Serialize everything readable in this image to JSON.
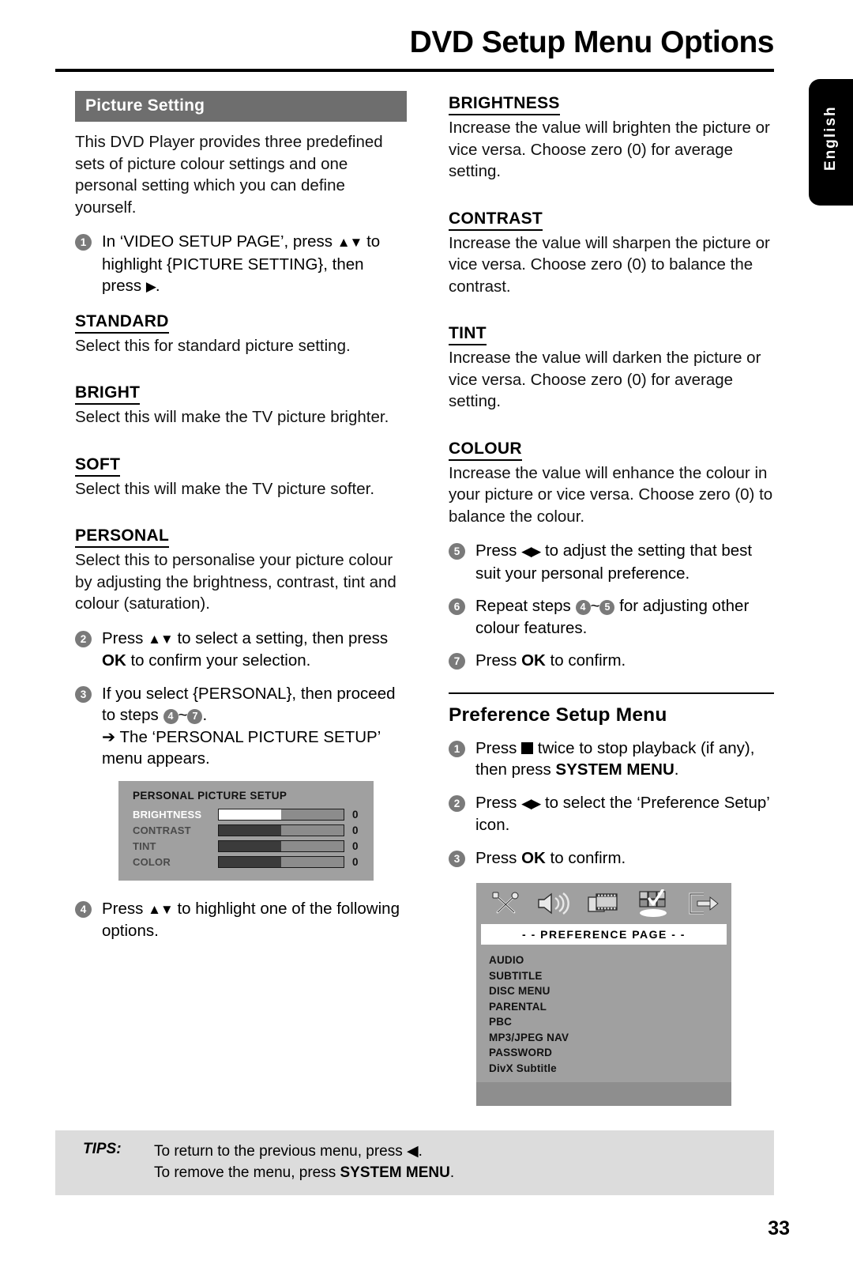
{
  "header": {
    "title": "DVD Setup Menu Options",
    "language_tab": "English"
  },
  "left_column": {
    "section_title": "Picture Setting",
    "intro": "This DVD Player provides three predefined sets of picture colour settings and one personal setting which you can define yourself.",
    "step1": {
      "num": "1",
      "text_a": "In ‘VIDEO SETUP PAGE’, press ",
      "arrows": "▲▼",
      "text_b": " to highlight {PICTURE SETTING}, then press ",
      "arrow_right": "▶",
      "text_c": "."
    },
    "terms": [
      {
        "name": "STANDARD",
        "desc": "Select this for standard picture setting."
      },
      {
        "name": "BRIGHT",
        "desc": "Select this will make the TV picture brighter."
      },
      {
        "name": "SOFT",
        "desc": "Select this will make the TV picture softer."
      },
      {
        "name": "PERSONAL",
        "desc": "Select this to personalise your picture colour by adjusting the brightness, contrast, tint and colour (saturation)."
      }
    ],
    "step2": {
      "num": "2",
      "text_a": "Press ",
      "arrows": "▲▼",
      "text_b": " to select a setting, then press ",
      "ok": "OK",
      "text_c": " to confirm your selection."
    },
    "step3": {
      "num": "3",
      "text_a": "If you select {PERSONAL}, then proceed to steps ",
      "range_from": "4",
      "range_sep": "~",
      "range_to": "7",
      "text_b": ".",
      "sub_arrow": "➔",
      "sub_text": "The ‘PERSONAL PICTURE SETUP’ menu appears."
    },
    "personal_picture_setup": {
      "title": "PERSONAL PICTURE SETUP",
      "rows": [
        {
          "label": "BRIGHTNESS",
          "value": "0",
          "selected": true
        },
        {
          "label": "CONTRAST",
          "value": "0",
          "selected": false
        },
        {
          "label": "TINT",
          "value": "0",
          "selected": false
        },
        {
          "label": "COLOR",
          "value": "0",
          "selected": false
        }
      ]
    },
    "step4": {
      "num": "4",
      "text_a": "Press ",
      "arrows": "▲▼",
      "text_b": " to highlight one of the following options."
    }
  },
  "right_column": {
    "terms": [
      {
        "name": "BRIGHTNESS",
        "desc": "Increase the value will brighten the picture or vice versa. Choose zero (0) for average setting."
      },
      {
        "name": "CONTRAST",
        "desc": "Increase the value will sharpen the picture or vice versa.  Choose zero (0) to balance the contrast."
      },
      {
        "name": "TINT",
        "desc": "Increase the value will darken the picture or vice versa.  Choose zero (0) for average setting."
      },
      {
        "name": "COLOUR",
        "desc": "Increase the value will enhance the colour in your picture or vice versa. Choose zero (0) to balance the colour."
      }
    ],
    "step5": {
      "num": "5",
      "text_a": "Press ",
      "arrows": "◀▶",
      "text_b": " to adjust the setting that best suit your personal preference."
    },
    "step6": {
      "num": "6",
      "text_a": "Repeat steps ",
      "range_from": "4",
      "range_sep": "~",
      "range_to": "5",
      "text_b": " for adjusting other colour features."
    },
    "step7": {
      "num": "7",
      "text_a": "Press ",
      "ok": "OK",
      "text_b": " to confirm."
    },
    "preference_section": {
      "heading": "Preference Setup Menu",
      "step1": {
        "num": "1",
        "text_a": "Press ",
        "stop_icon": "stop-square-icon",
        "text_b": " twice to stop playback (if any), then press ",
        "system_menu": "SYSTEM MENU",
        "text_c": "."
      },
      "step2": {
        "num": "2",
        "text_a": "Press ",
        "arrows": "◀▶",
        "text_b": " to select the ‘Preference Setup’ icon."
      },
      "step3": {
        "num": "3",
        "text_a": "Press ",
        "ok": "OK",
        "text_b": " to confirm."
      },
      "preference_page": {
        "icons": [
          "tools-icon",
          "speaker-icon",
          "film-icon",
          "preference-grid-icon",
          "exit-icon"
        ],
        "selected_icon": "preference-grid-icon",
        "title": "- -  PREFERENCE  PAGE  - -",
        "items": [
          "AUDIO",
          "SUBTITLE",
          "DISC MENU",
          "PARENTAL",
          "PBC",
          "MP3/JPEG NAV",
          "PASSWORD",
          "DivX Subtitle"
        ]
      }
    }
  },
  "tips": {
    "label": "TIPS:",
    "line1_a": "To return to the previous menu, press ",
    "line1_arrow": "◀",
    "line1_b": ".",
    "line2_a": "To remove the menu, press ",
    "line2_bold": "SYSTEM MENU",
    "line2_b": "."
  },
  "page_number": "33",
  "colors": {
    "section_bar": "#6e6e6e",
    "bullet": "#7a7a7a",
    "osd_background": "#a0a0a0",
    "tips_background": "#dcdcdc"
  }
}
